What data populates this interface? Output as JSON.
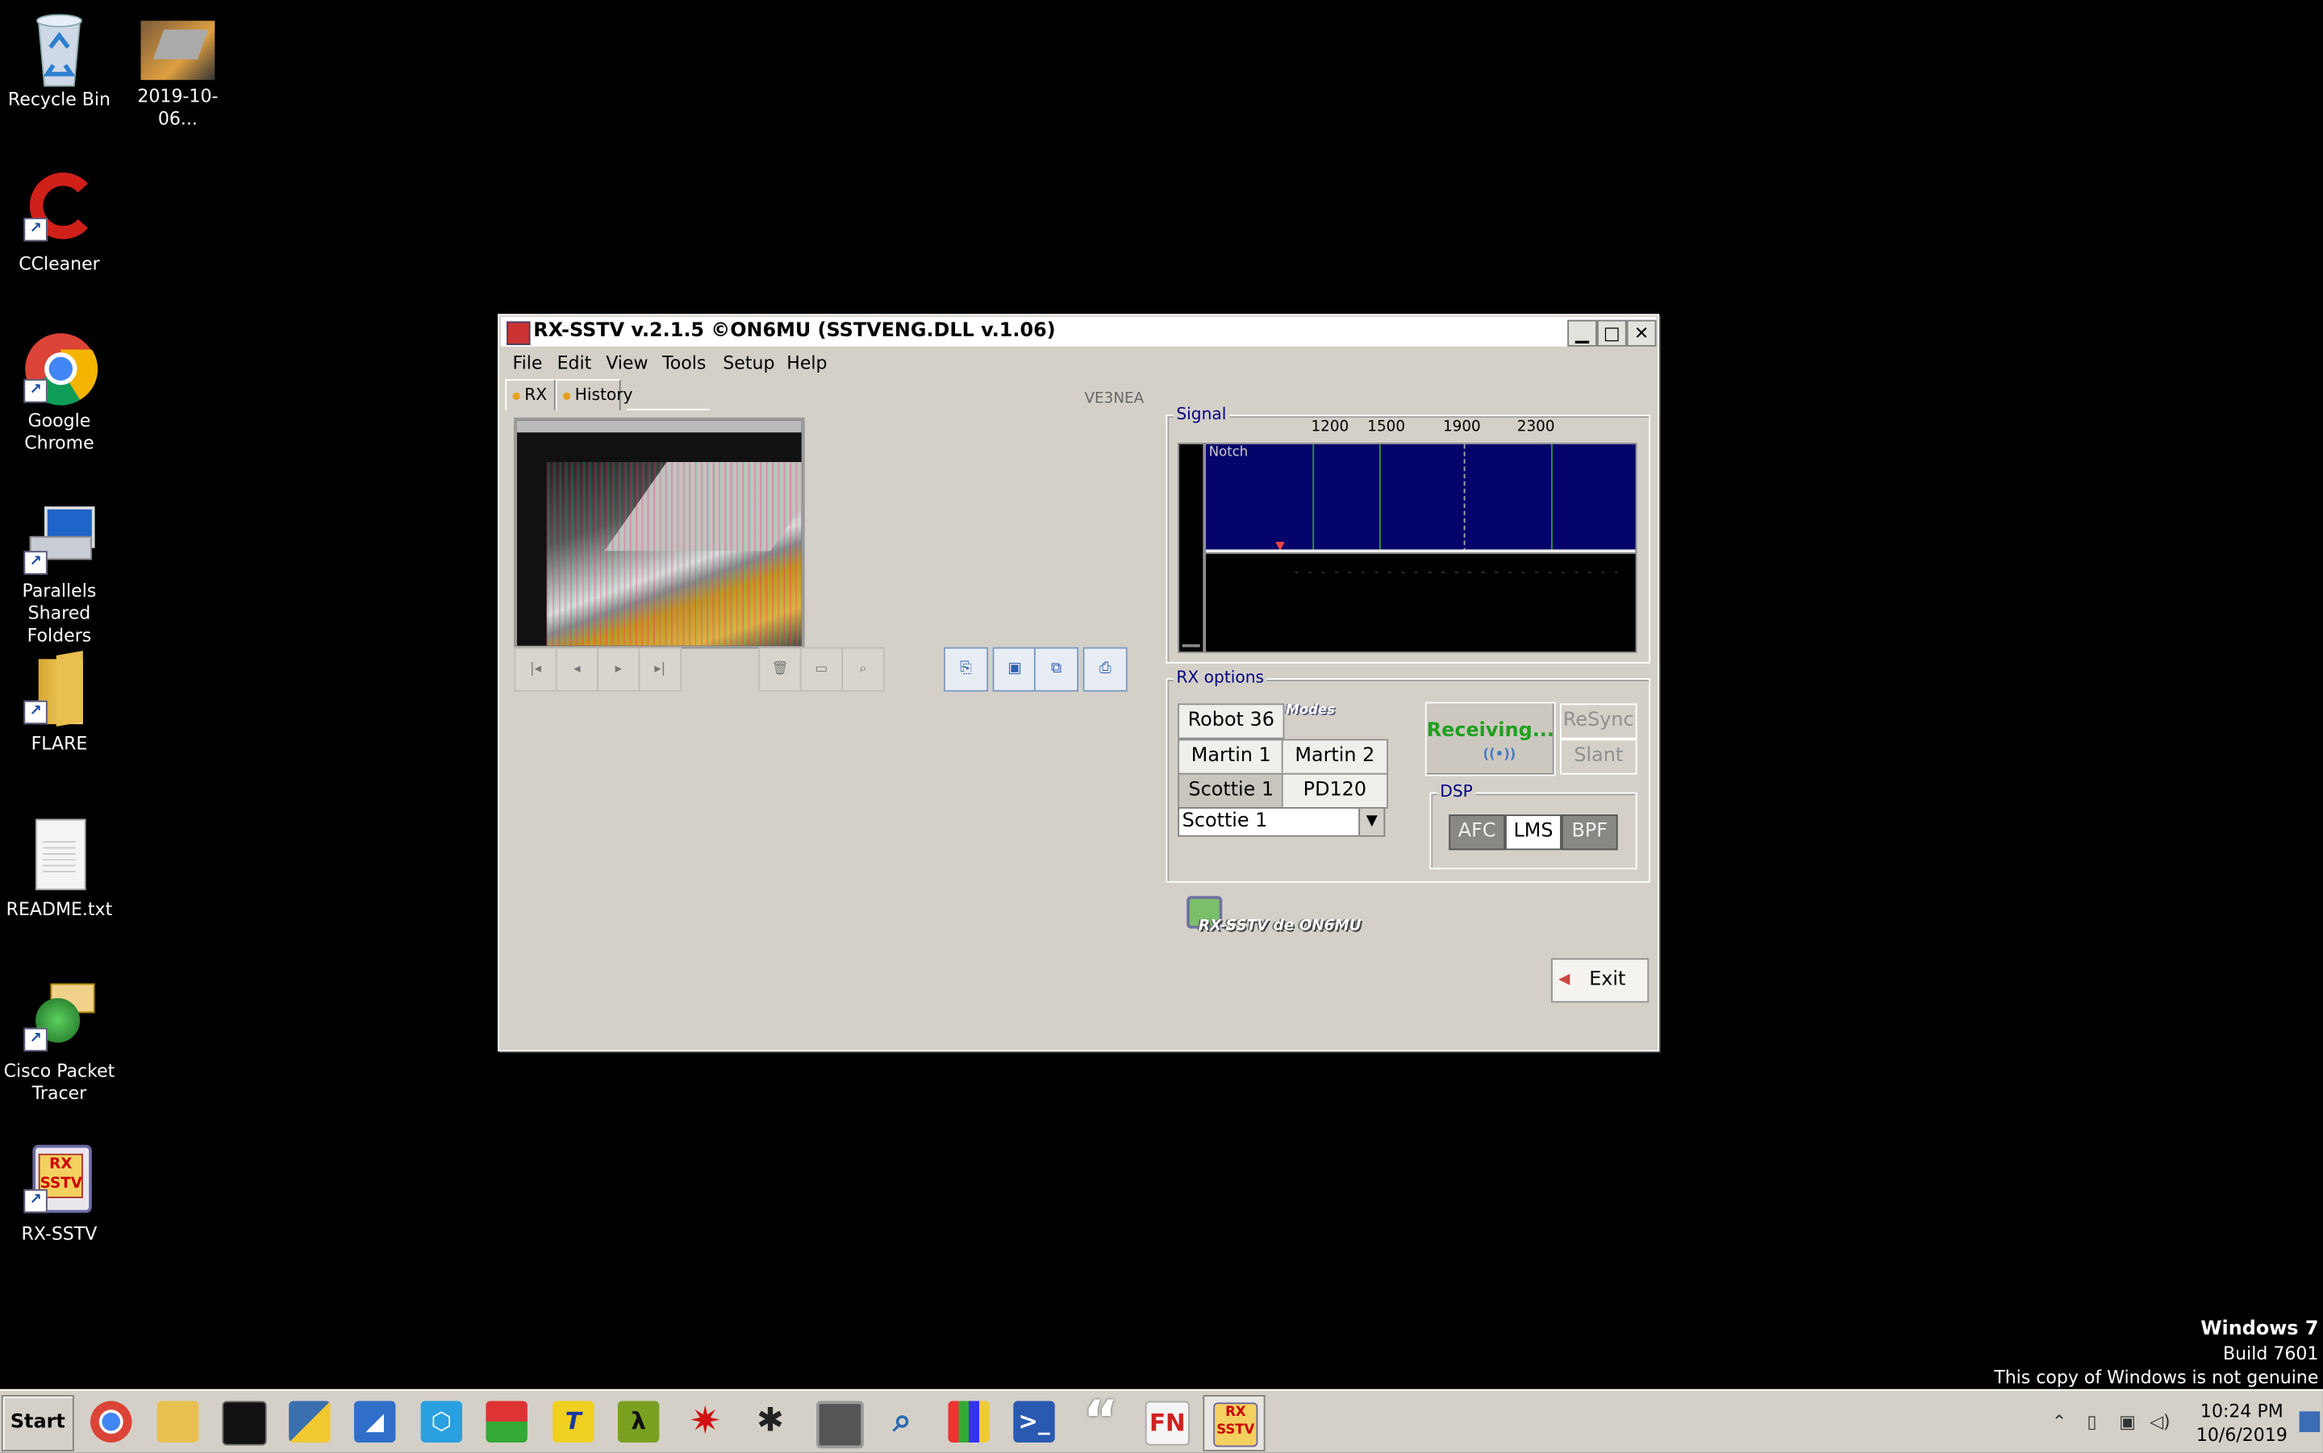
{
  "desktop": {
    "icons": [
      {
        "label": "Recycle Bin"
      },
      {
        "label": "2019-10-06..."
      },
      {
        "label": "CCleaner"
      },
      {
        "label": "Google Chrome"
      },
      {
        "label": "Parallels Shared Folders"
      },
      {
        "label": "FLARE"
      },
      {
        "label": "README.txt"
      },
      {
        "label": "Cisco Packet Tracer"
      },
      {
        "label": "RX-SSTV"
      }
    ],
    "watermark": {
      "line1": "Windows 7",
      "line2": "Build 7601",
      "line3": "This copy of Windows is not genuine"
    }
  },
  "window": {
    "title": "RX-SSTV v.2.1.5 ©ON6MU (SSTVENG.DLL v.1.06)",
    "menu": [
      "File",
      "Edit",
      "View",
      "Tools",
      "Setup",
      "Help"
    ],
    "tabs": [
      "RX",
      "History"
    ],
    "callsign": "VE3NEA",
    "signal": {
      "title": "Signal",
      "freq_labels": [
        "1200",
        "1500",
        "1900",
        "2300"
      ],
      "notch_label": "Notch"
    },
    "rx_options": {
      "title": "RX options",
      "modes_label": "Modes",
      "mode_buttons": [
        "Robot 36",
        "Martin 1",
        "Martin 2",
        "Scottie 1",
        "PD120"
      ],
      "selected_mode": "Scottie 1",
      "status": "Receiving...",
      "resync": "ReSync",
      "slant": "Slant",
      "dsp_title": "DSP",
      "dsp_buttons": [
        "AFC",
        "LMS",
        "BPF"
      ]
    },
    "logo": "RX-SSTV de ON6MU",
    "exit_label": "Exit"
  },
  "taskbar": {
    "start_label": "Start",
    "time": "10:24 PM",
    "date": "10/6/2019",
    "apps": [
      "chrome-icon",
      "explorer-icon",
      "terminal-icon",
      "python-icon",
      "wireshark-icon",
      "network-icon",
      "blocks-icon",
      "text-icon",
      "lambda-icon",
      "splat-icon",
      "bug-icon",
      "monitor-icon",
      "search-icon",
      "control-panel-icon",
      "powershell-icon",
      "quote-icon",
      "fn-icon",
      "rxsstv-icon"
    ]
  }
}
